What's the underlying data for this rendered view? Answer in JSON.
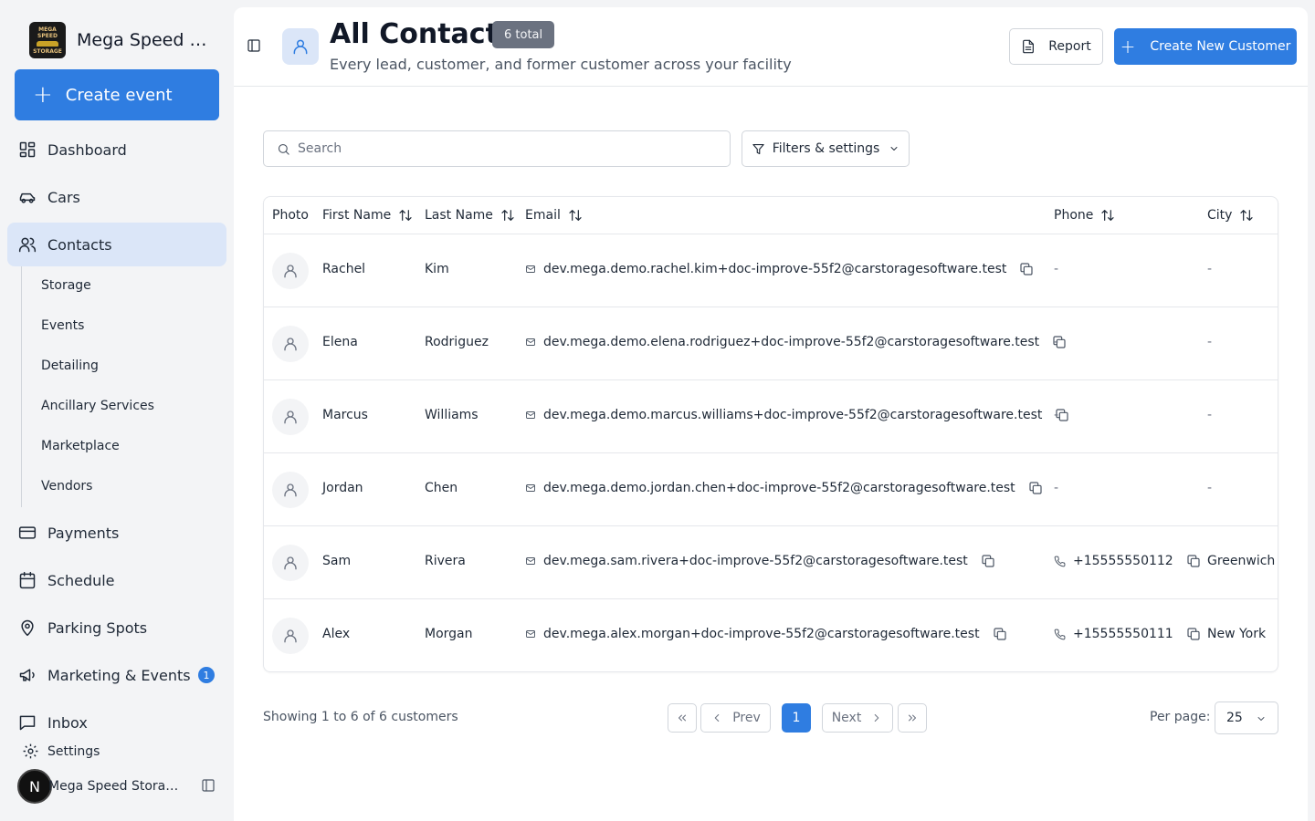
{
  "sidebar": {
    "brand_name": "Mega Speed St...",
    "logo_text": "MEGA SPEED STORAGE",
    "create_event_label": "Create event",
    "items": [
      {
        "label": "Dashboard"
      },
      {
        "label": "Cars"
      },
      {
        "label": "Contacts"
      },
      {
        "label": "Payments"
      },
      {
        "label": "Schedule"
      },
      {
        "label": "Parking Spots"
      },
      {
        "label": "Marketing & Events",
        "badge": "1"
      },
      {
        "label": "Inbox"
      }
    ],
    "sub_items": [
      {
        "label": "Storage"
      },
      {
        "label": "Events"
      },
      {
        "label": "Detailing"
      },
      {
        "label": "Ancillary Services"
      },
      {
        "label": "Marketplace"
      },
      {
        "label": "Vendors"
      }
    ],
    "settings_label": "Settings",
    "user": {
      "initial": "N",
      "name": "Mega Speed Storag..."
    }
  },
  "header": {
    "title": "All Contacts",
    "total_badge": "6 total",
    "subtitle": "Every lead, customer, and former customer across your facility",
    "report_label": "Report",
    "create_label": "Create New Customer"
  },
  "toolbar": {
    "search_placeholder": "Search",
    "filters_label": "Filters & settings"
  },
  "table": {
    "columns": [
      "Photo",
      "First Name",
      "Last Name",
      "Email",
      "Phone",
      "City"
    ],
    "rows": [
      {
        "first": "Rachel",
        "last": "Kim",
        "email": "dev.mega.demo.rachel.kim+doc-improve-55f2@carstoragesoftware.test",
        "phone": "-",
        "city": "-"
      },
      {
        "first": "Elena",
        "last": "Rodriguez",
        "email": "dev.mega.demo.elena.rodriguez+doc-improve-55f2@carstoragesoftware.test",
        "phone": "-",
        "city": "-"
      },
      {
        "first": "Marcus",
        "last": "Williams",
        "email": "dev.mega.demo.marcus.williams+doc-improve-55f2@carstoragesoftware.test",
        "phone": "-",
        "city": "-"
      },
      {
        "first": "Jordan",
        "last": "Chen",
        "email": "dev.mega.demo.jordan.chen+doc-improve-55f2@carstoragesoftware.test",
        "phone": "-",
        "city": "-"
      },
      {
        "first": "Sam",
        "last": "Rivera",
        "email": "dev.mega.sam.rivera+doc-improve-55f2@carstoragesoftware.test",
        "phone": "+15555550112",
        "city": "Greenwich"
      },
      {
        "first": "Alex",
        "last": "Morgan",
        "email": "dev.mega.alex.morgan+doc-improve-55f2@carstoragesoftware.test",
        "phone": "+15555550111",
        "city": "New York"
      }
    ]
  },
  "pagination": {
    "summary": "Showing 1 to 6 of 6 customers",
    "prev_label": "Prev",
    "next_label": "Next",
    "current_page": "1",
    "per_page_label": "Per page:",
    "per_page_value": "25"
  },
  "colors": {
    "accent": "#2f7de1",
    "active_nav": "#dbe6f8"
  }
}
